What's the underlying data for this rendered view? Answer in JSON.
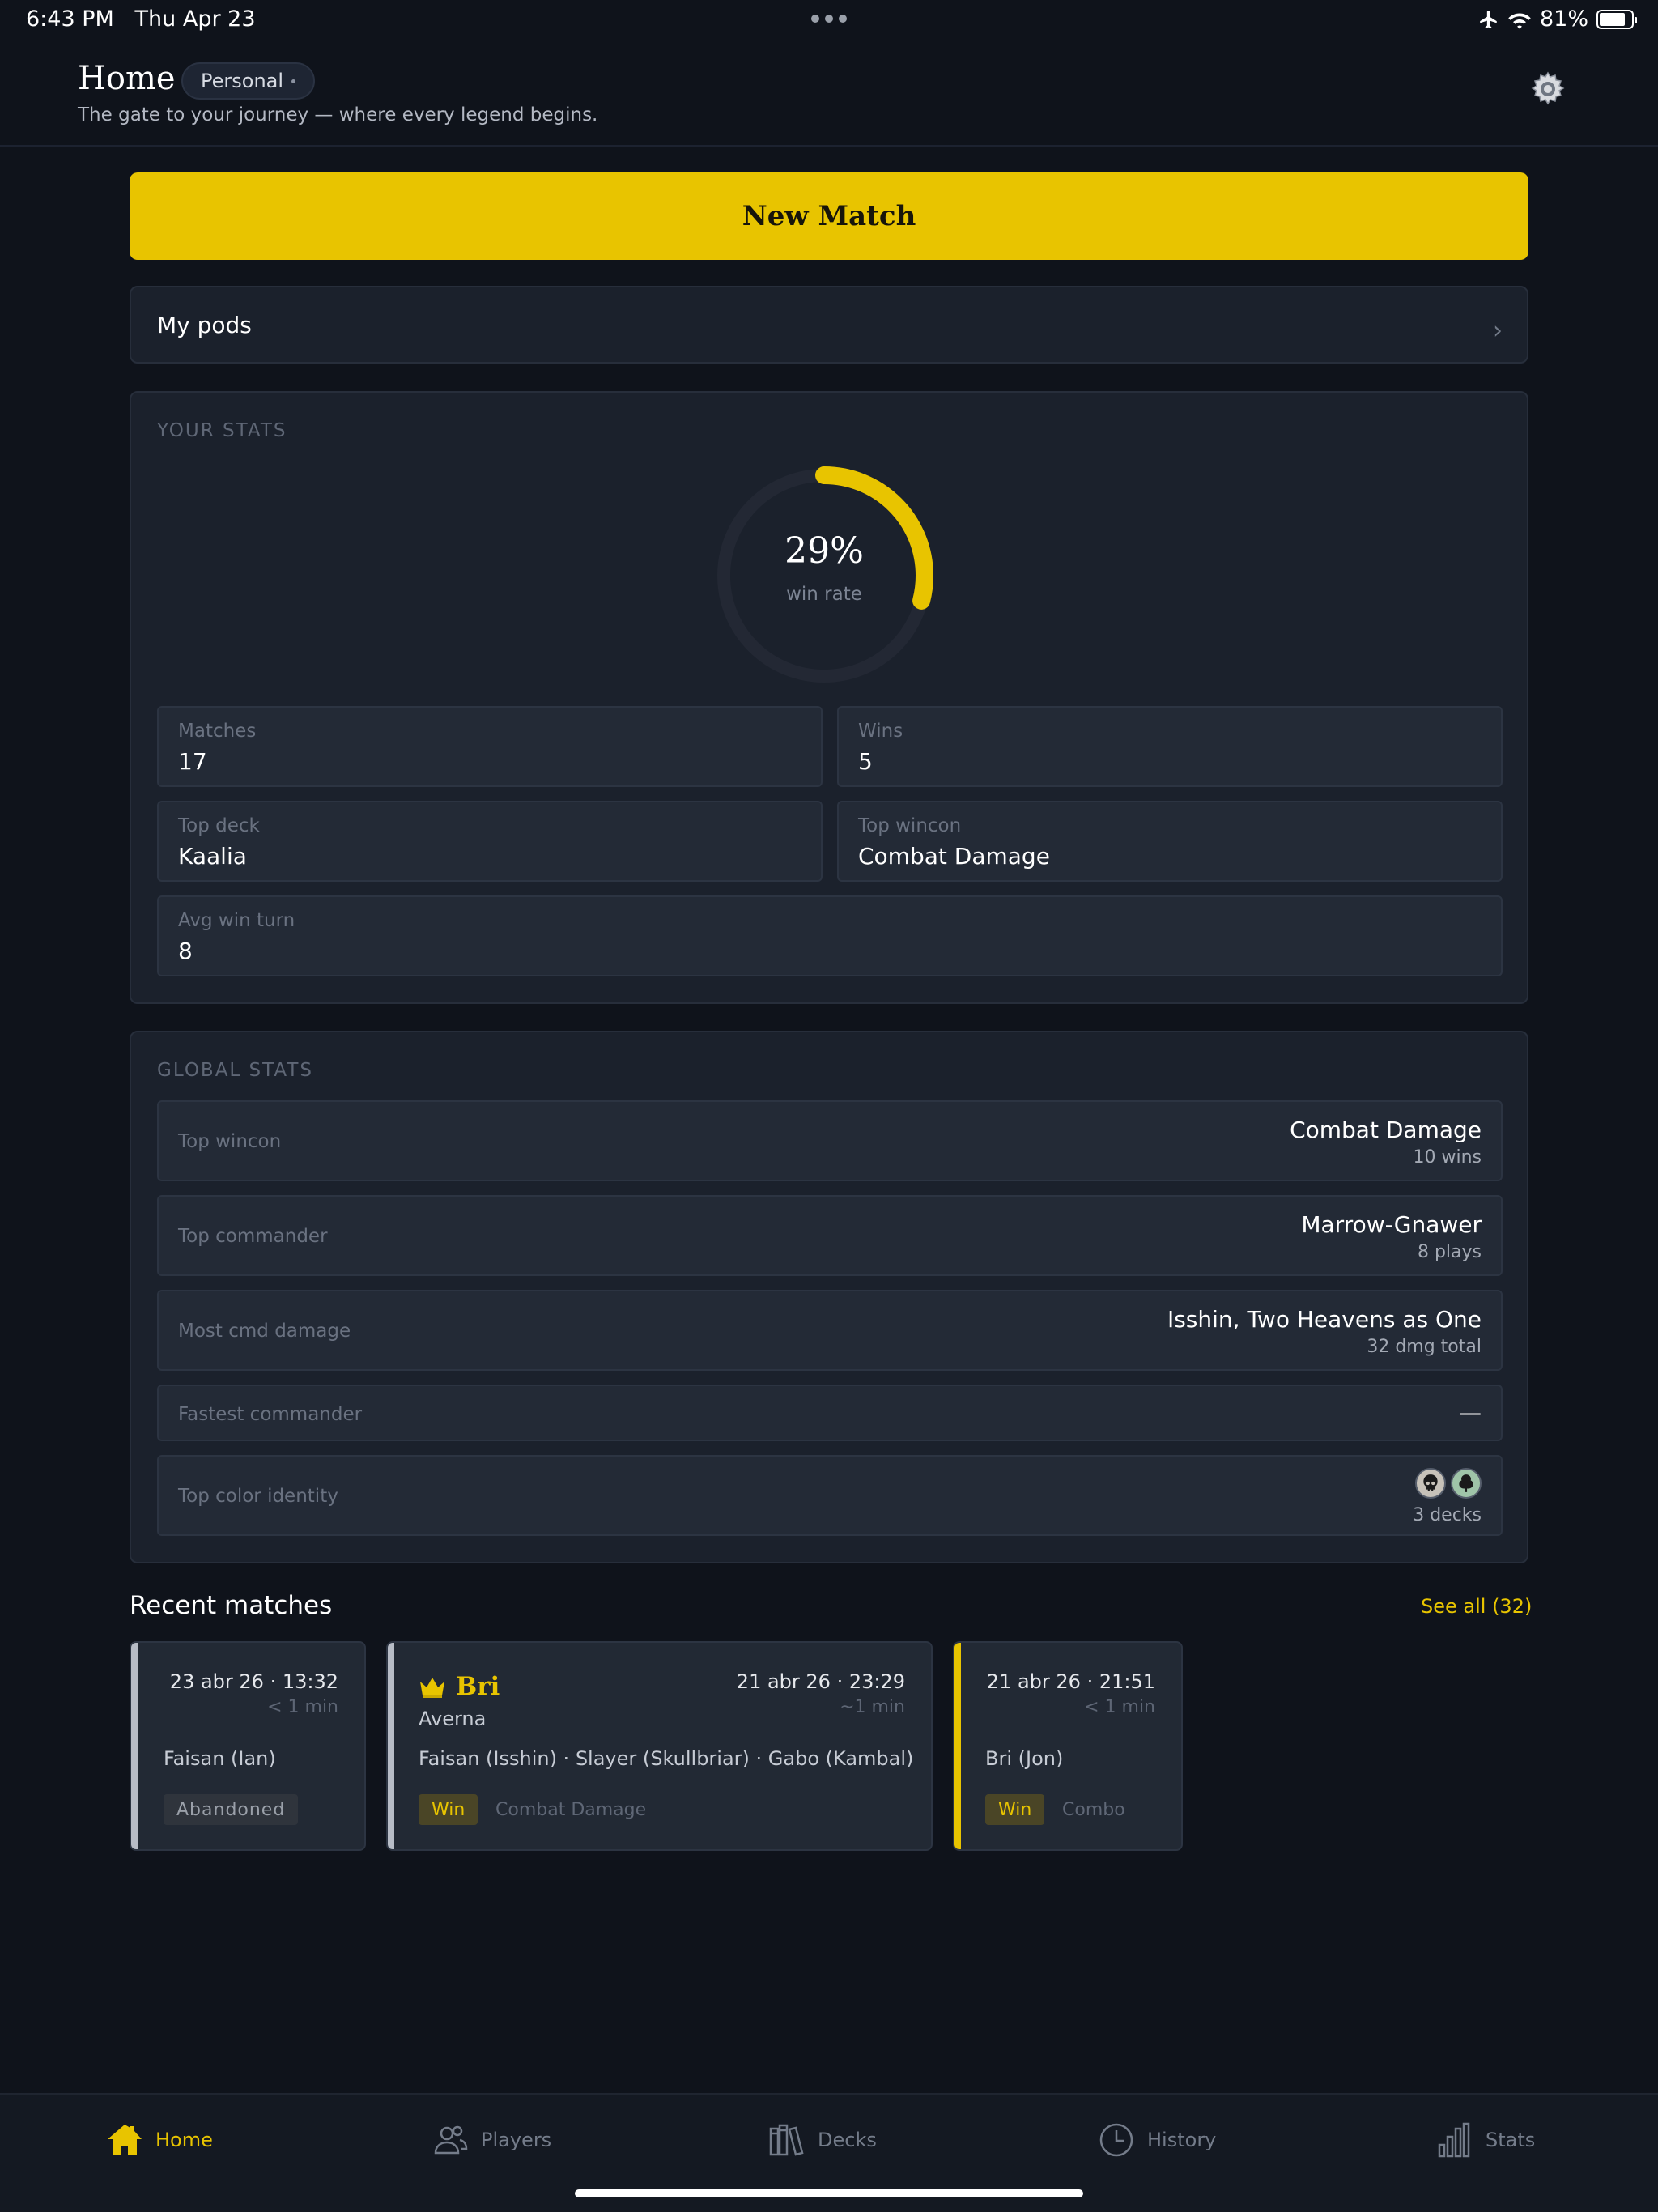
{
  "status_bar": {
    "time": "6:43 PM",
    "date": "Thu Apr 23",
    "battery": "81%",
    "battery_level": 0.81
  },
  "header": {
    "title": "Home",
    "context": "Personal",
    "subtitle": "The gate to your journey — where every legend begins.",
    "settings_icon": "gear-icon"
  },
  "actions": {
    "new_match": "New Match",
    "my_pods": "My pods"
  },
  "your_stats": {
    "label": "YOUR STATS",
    "win_rate": "29%",
    "win_rate_value": 0.29,
    "win_rate_caption": "win rate",
    "matches_label": "Matches",
    "matches": "17",
    "wins_label": "Wins",
    "wins": "5",
    "top_deck_label": "Top deck",
    "top_deck": "Kaalia",
    "top_wincon_label": "Top wincon",
    "top_wincon": "Combat Damage",
    "avg_win_turn_label": "Avg win turn",
    "avg_win_turn": "8"
  },
  "global_stats": {
    "label": "GLOBAL STATS",
    "rows": [
      {
        "label": "Top wincon",
        "value": "Combat Damage",
        "sub": "10 wins"
      },
      {
        "label": "Top commander",
        "value": "Marrow-Gnawer",
        "sub": "8 plays"
      },
      {
        "label": "Most cmd damage",
        "value": "Isshin, Two Heavens as One",
        "sub": "32 dmg total"
      },
      {
        "label": "Fastest commander",
        "value": "—"
      },
      {
        "label": "Top color identity",
        "sub": "3 decks",
        "colors": [
          "black",
          "green"
        ]
      }
    ]
  },
  "recent": {
    "title": "Recent matches",
    "see_all": "See all (32)",
    "matches": [
      {
        "date": "23 abr 26 · 13:32",
        "duration": "< 1 min",
        "players": "Faisan (Ian)",
        "result": "Abandoned"
      },
      {
        "winner": "Bri",
        "deck": "Averna",
        "date": "21 abr 26 · 23:29",
        "duration": "~1 min",
        "players": "Faisan (Isshin) · Slayer (Skullbriar) · Gabo (Kambal)",
        "result": "Win",
        "wincon": "Combat Damage"
      },
      {
        "date": "21 abr 26 · 21:51",
        "duration": "< 1 min",
        "players": "Bri (Jon)",
        "result": "Win",
        "wincon": "Combo"
      }
    ]
  },
  "tabs": [
    {
      "label": "Home",
      "icon": "house-icon",
      "active": true
    },
    {
      "label": "Players",
      "icon": "users-icon"
    },
    {
      "label": "Decks",
      "icon": "books-icon"
    },
    {
      "label": "History",
      "icon": "clock-icon"
    },
    {
      "label": "Stats",
      "icon": "bar-chart-icon"
    }
  ],
  "colors": {
    "accent": "#e8c400",
    "background": "#0f131b",
    "panel": "#1b212c"
  }
}
